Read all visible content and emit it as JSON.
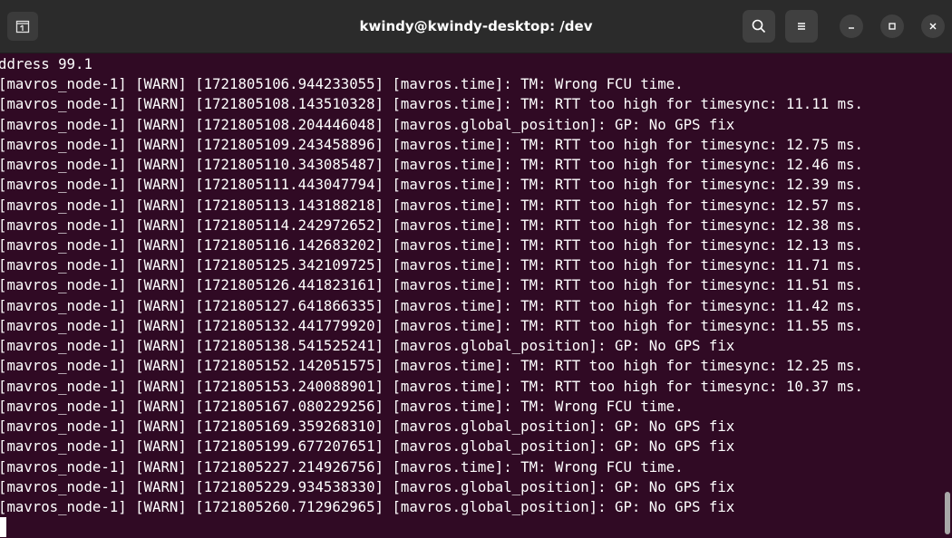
{
  "window": {
    "title": "kwindy@kwindy-desktop: /dev"
  },
  "icons": {
    "new_tab": "new-tab-icon",
    "search": "search-icon",
    "menu": "hamburger-menu-icon",
    "minimize": "minimize-icon",
    "maximize": "maximize-icon",
    "close": "close-icon"
  },
  "colors": {
    "terminal_bg": "#300a24",
    "titlebar_bg": "#2b2b2b",
    "text": "#ffffff"
  },
  "terminal": {
    "lines": [
      "ddress 99.1",
      "[mavros_node-1] [WARN] [1721805106.944233055] [mavros.time]: TM: Wrong FCU time.",
      "[mavros_node-1] [WARN] [1721805108.143510328] [mavros.time]: TM: RTT too high for timesync: 11.11 ms.",
      "[mavros_node-1] [WARN] [1721805108.204446048] [mavros.global_position]: GP: No GPS fix",
      "[mavros_node-1] [WARN] [1721805109.243458896] [mavros.time]: TM: RTT too high for timesync: 12.75 ms.",
      "[mavros_node-1] [WARN] [1721805110.343085487] [mavros.time]: TM: RTT too high for timesync: 12.46 ms.",
      "[mavros_node-1] [WARN] [1721805111.443047794] [mavros.time]: TM: RTT too high for timesync: 12.39 ms.",
      "[mavros_node-1] [WARN] [1721805113.143188218] [mavros.time]: TM: RTT too high for timesync: 12.57 ms.",
      "[mavros_node-1] [WARN] [1721805114.242972652] [mavros.time]: TM: RTT too high for timesync: 12.38 ms.",
      "[mavros_node-1] [WARN] [1721805116.142683202] [mavros.time]: TM: RTT too high for timesync: 12.13 ms.",
      "[mavros_node-1] [WARN] [1721805125.342109725] [mavros.time]: TM: RTT too high for timesync: 11.71 ms.",
      "[mavros_node-1] [WARN] [1721805126.441823161] [mavros.time]: TM: RTT too high for timesync: 11.51 ms.",
      "[mavros_node-1] [WARN] [1721805127.641866335] [mavros.time]: TM: RTT too high for timesync: 11.42 ms.",
      "[mavros_node-1] [WARN] [1721805132.441779920] [mavros.time]: TM: RTT too high for timesync: 11.55 ms.",
      "[mavros_node-1] [WARN] [1721805138.541525241] [mavros.global_position]: GP: No GPS fix",
      "[mavros_node-1] [WARN] [1721805152.142051575] [mavros.time]: TM: RTT too high for timesync: 12.25 ms.",
      "[mavros_node-1] [WARN] [1721805153.240088901] [mavros.time]: TM: RTT too high for timesync: 10.37 ms.",
      "[mavros_node-1] [WARN] [1721805167.080229256] [mavros.time]: TM: Wrong FCU time.",
      "[mavros_node-1] [WARN] [1721805169.359268310] [mavros.global_position]: GP: No GPS fix",
      "[mavros_node-1] [WARN] [1721805199.677207651] [mavros.global_position]: GP: No GPS fix",
      "[mavros_node-1] [WARN] [1721805227.214926756] [mavros.time]: TM: Wrong FCU time.",
      "[mavros_node-1] [WARN] [1721805229.934538330] [mavros.global_position]: GP: No GPS fix",
      "[mavros_node-1] [WARN] [1721805260.712962965] [mavros.global_position]: GP: No GPS fix"
    ]
  }
}
